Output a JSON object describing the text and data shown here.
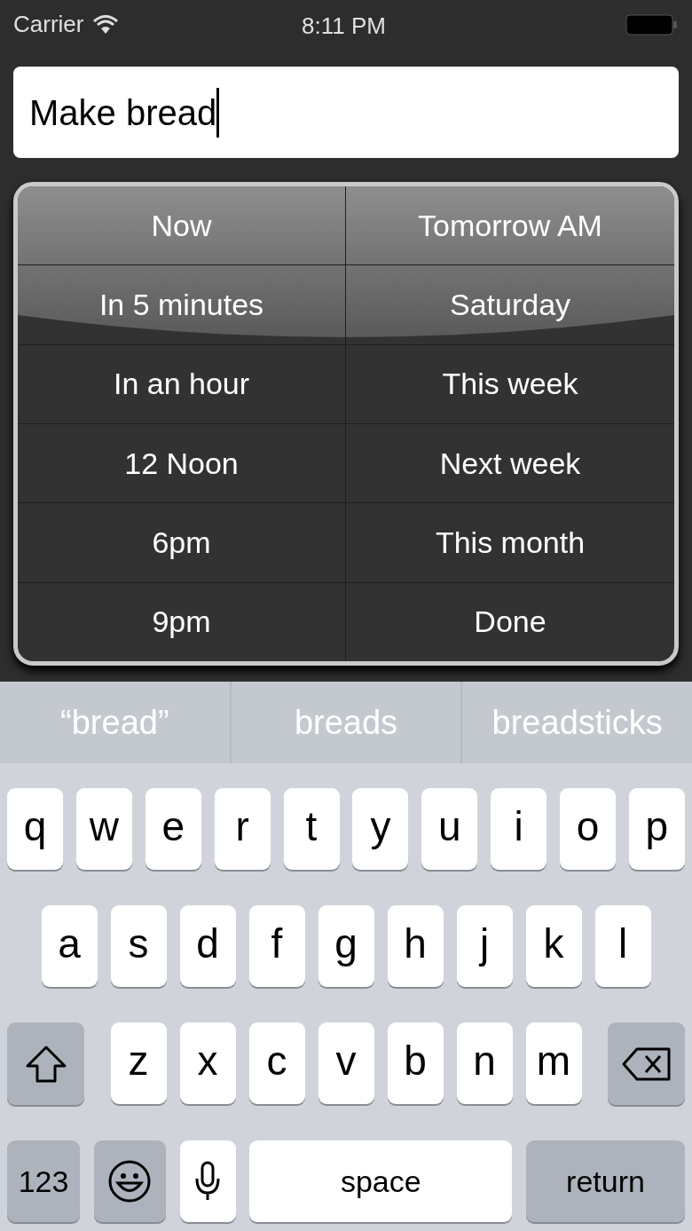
{
  "status_bar": {
    "carrier": "Carrier",
    "time": "8:11 PM"
  },
  "text_field": {
    "value": "Make bread"
  },
  "options": [
    {
      "label": "Now"
    },
    {
      "label": "Tomorrow AM"
    },
    {
      "label": "In 5 minutes"
    },
    {
      "label": "Saturday"
    },
    {
      "label": "In an hour"
    },
    {
      "label": "This week"
    },
    {
      "label": "12 Noon"
    },
    {
      "label": "Next week"
    },
    {
      "label": "6pm"
    },
    {
      "label": "This month"
    },
    {
      "label": "9pm"
    },
    {
      "label": "Done"
    }
  ],
  "suggestions": [
    "“bread”",
    "breads",
    "breadsticks"
  ],
  "keyboard": [
    [
      {
        "kind": "letter",
        "label": "q"
      },
      {
        "kind": "letter",
        "label": "w"
      },
      {
        "kind": "letter",
        "label": "e"
      },
      {
        "kind": "letter",
        "label": "r"
      },
      {
        "kind": "letter",
        "label": "t"
      },
      {
        "kind": "letter",
        "label": "y"
      },
      {
        "kind": "letter",
        "label": "u"
      },
      {
        "kind": "letter",
        "label": "i"
      },
      {
        "kind": "letter",
        "label": "o"
      },
      {
        "kind": "letter",
        "label": "p"
      }
    ],
    [
      {
        "kind": "letter",
        "label": "a"
      },
      {
        "kind": "letter",
        "label": "s"
      },
      {
        "kind": "letter",
        "label": "d"
      },
      {
        "kind": "letter",
        "label": "f"
      },
      {
        "kind": "letter",
        "label": "g"
      },
      {
        "kind": "letter",
        "label": "h"
      },
      {
        "kind": "letter",
        "label": "j"
      },
      {
        "kind": "letter",
        "label": "k"
      },
      {
        "kind": "letter",
        "label": "l"
      }
    ],
    [
      {
        "kind": "shift"
      },
      {
        "kind": "letter",
        "label": "z"
      },
      {
        "kind": "letter",
        "label": "x"
      },
      {
        "kind": "letter",
        "label": "c"
      },
      {
        "kind": "letter",
        "label": "v"
      },
      {
        "kind": "letter",
        "label": "b"
      },
      {
        "kind": "letter",
        "label": "n"
      },
      {
        "kind": "letter",
        "label": "m"
      },
      {
        "kind": "delete"
      }
    ],
    [
      {
        "kind": "numbers",
        "label": "123"
      },
      {
        "kind": "emoji"
      },
      {
        "kind": "mic"
      },
      {
        "kind": "space",
        "label": "space"
      },
      {
        "kind": "return",
        "label": "return"
      }
    ]
  ]
}
